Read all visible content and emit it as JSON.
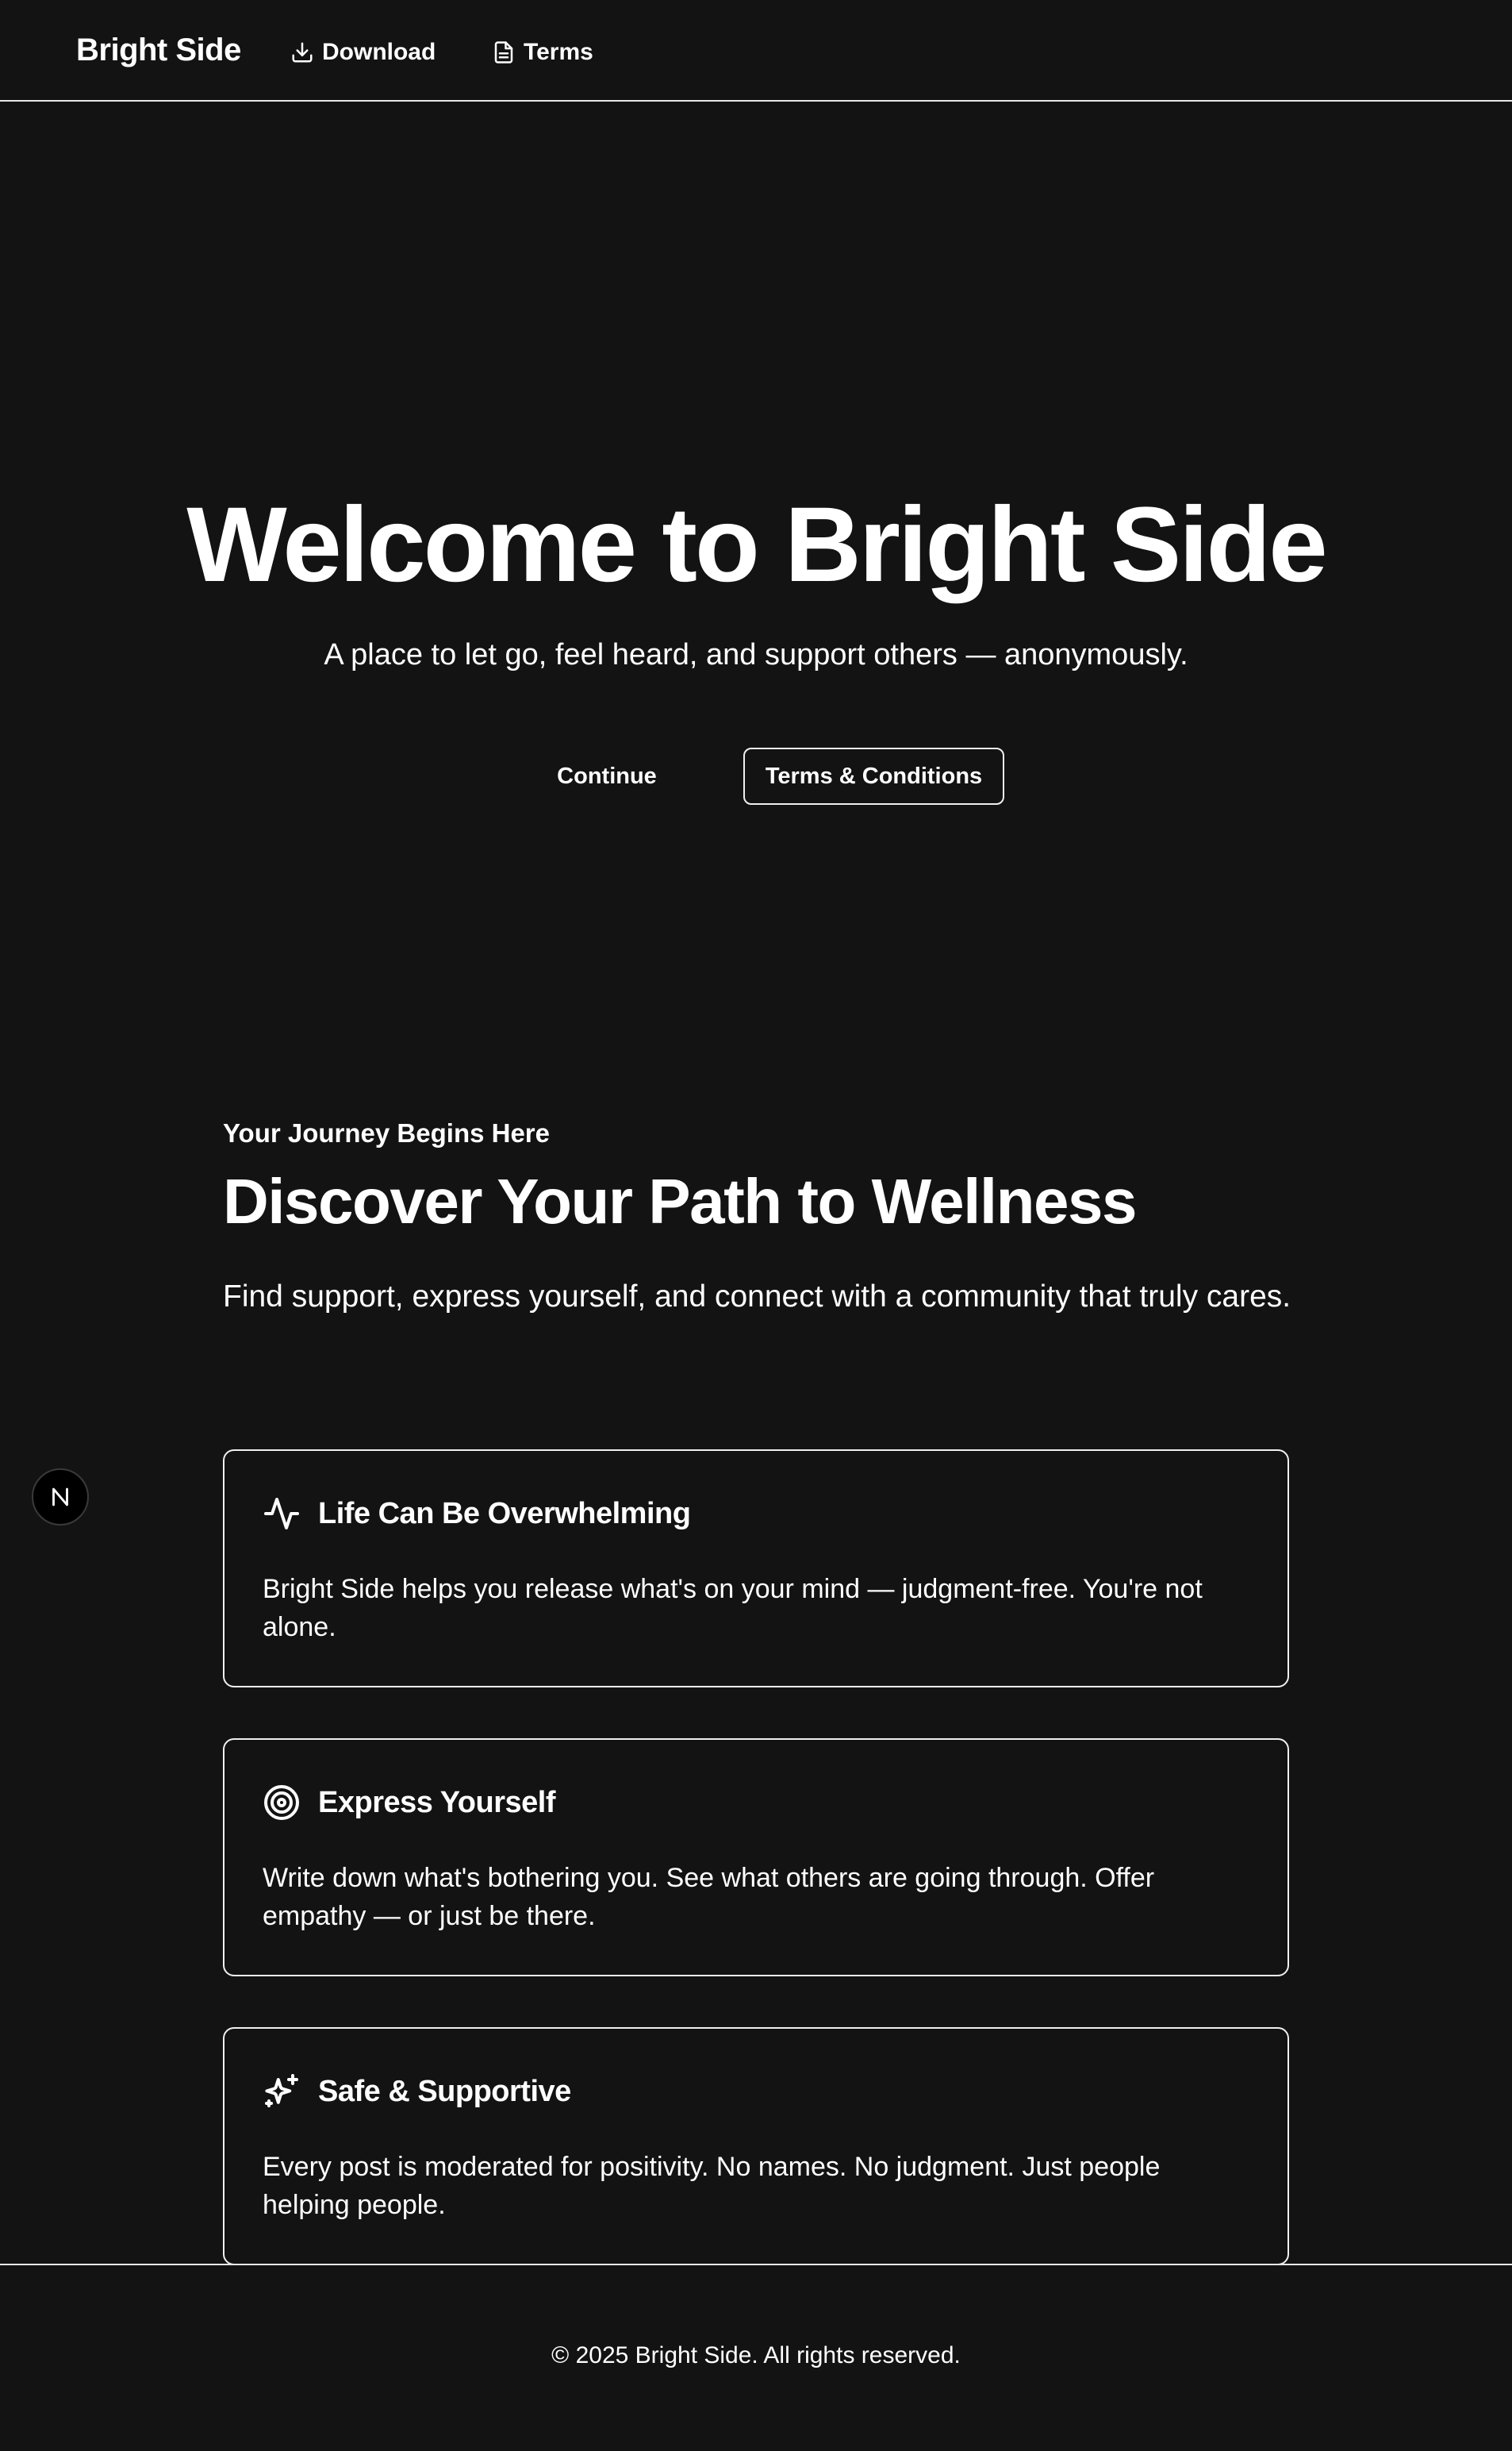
{
  "header": {
    "brand": "Bright Side",
    "nav": [
      {
        "label": "Download",
        "icon": "download-icon"
      },
      {
        "label": "Terms",
        "icon": "document-icon"
      }
    ]
  },
  "hero": {
    "title": "Welcome to Bright Side",
    "subtitle": "A place to let go, feel heard, and support others — anonymously.",
    "continue_label": "Continue",
    "terms_label": "Terms & Conditions"
  },
  "journey": {
    "eyebrow": "Your Journey Begins Here",
    "title": "Discover Your Path to Wellness",
    "description": "Find support, express yourself, and connect with a community that truly cares."
  },
  "cards": [
    {
      "icon": "pulse-icon",
      "title": "Life Can Be Overwhelming",
      "body": "Bright Side helps you release what's on your mind — judgment-free. You're not alone."
    },
    {
      "icon": "target-icon",
      "title": "Express Yourself",
      "body": "Write down what's bothering you. See what others are going through. Offer empathy — or just be there."
    },
    {
      "icon": "sparkles-icon",
      "title": "Safe & Supportive",
      "body": "Every post is moderated for positivity. No names. No judgment. Just people helping people."
    }
  ],
  "badge": {
    "icon": "n-logo-icon"
  },
  "footer": {
    "copyright": "© 2025 Bright Side. All rights reserved."
  },
  "colors": {
    "background": "#131313",
    "text": "#ffffff",
    "border": "#f0f0f0"
  }
}
